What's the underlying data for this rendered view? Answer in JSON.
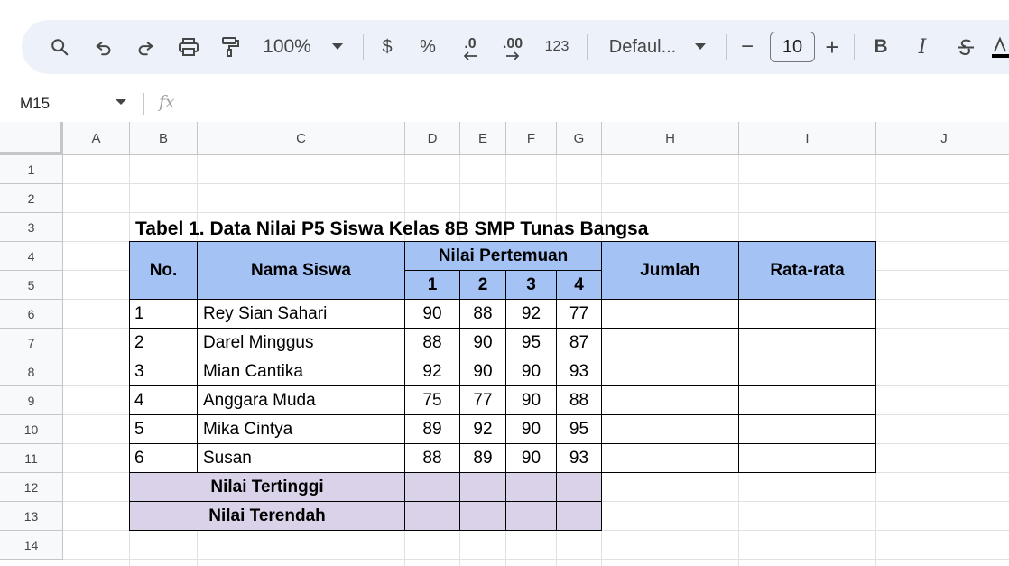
{
  "toolbar": {
    "zoom": "100%",
    "currency": "$",
    "percent": "%",
    "decrease_decimal": ".0",
    "increase_decimal": ".00",
    "number_format": "123",
    "font": "Defaul...",
    "font_size": "10",
    "minus": "−",
    "plus": "+",
    "bold": "B",
    "italic": "I"
  },
  "formula_bar": {
    "cell_ref": "M15",
    "fx": "fx",
    "value": ""
  },
  "columns": [
    "A",
    "B",
    "C",
    "D",
    "E",
    "F",
    "G",
    "H",
    "I",
    "J"
  ],
  "rows": [
    "1",
    "2",
    "3",
    "4",
    "5",
    "6",
    "7",
    "8",
    "9",
    "10",
    "11",
    "12",
    "13",
    "14"
  ],
  "sheet": {
    "title": "Tabel 1. Data Nilai P5 Siswa Kelas 8B SMP Tunas Bangsa",
    "headers": {
      "no": "No.",
      "nama": "Nama Siswa",
      "nilai_pertemuan": "Nilai Pertemuan",
      "p1": "1",
      "p2": "2",
      "p3": "3",
      "p4": "4",
      "jumlah": "Jumlah",
      "rata": "Rata-rata"
    },
    "students": [
      {
        "no": "1",
        "name": "Rey  Sian Sahari",
        "scores": [
          "90",
          "88",
          "92",
          "77"
        ]
      },
      {
        "no": "2",
        "name": "Darel Minggus",
        "scores": [
          "88",
          "90",
          "95",
          "87"
        ]
      },
      {
        "no": "3",
        "name": "Mian Cantika",
        "scores": [
          "92",
          "90",
          "90",
          "93"
        ]
      },
      {
        "no": "4",
        "name": "Anggara Muda",
        "scores": [
          "75",
          "77",
          "90",
          "88"
        ]
      },
      {
        "no": "5",
        "name": "Mika Cintya",
        "scores": [
          "89",
          "92",
          "90",
          "95"
        ]
      },
      {
        "no": "6",
        "name": "Susan",
        "scores": [
          "88",
          "89",
          "90",
          "93"
        ]
      }
    ],
    "nilai_tertinggi": "Nilai Tertinggi",
    "nilai_terendah": "Nilai Terendah"
  },
  "colors": {
    "header_blue": "#a4c2f4",
    "summary_purple": "#d9d2e9",
    "toolbar_bg": "#edf2fa"
  }
}
